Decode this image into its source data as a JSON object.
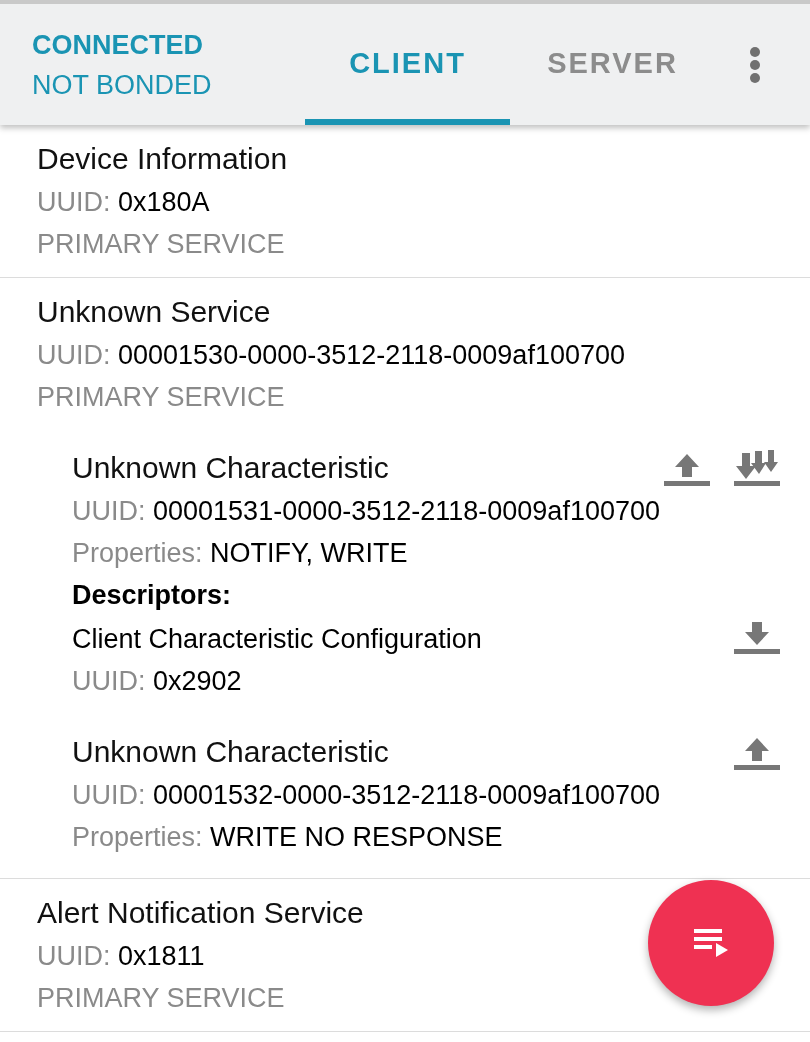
{
  "status": {
    "connection": "CONNECTED",
    "bond": "NOT BONDED"
  },
  "tabs": [
    {
      "label": "CLIENT",
      "selected": true
    },
    {
      "label": "SERVER",
      "selected": false
    }
  ],
  "services": [
    {
      "name": "Device Information",
      "uuid_label": "UUID:",
      "uuid": "0x180A",
      "type": "PRIMARY SERVICE"
    },
    {
      "name": "Unknown Service",
      "uuid_label": "UUID:",
      "uuid": "00001530-0000-3512-2118-0009af100700",
      "type": "PRIMARY SERVICE",
      "characteristics": [
        {
          "name": "Unknown Characteristic",
          "uuid_label": "UUID:",
          "uuid": "00001531-0000-3512-2118-0009af100700",
          "properties_label": "Properties:",
          "properties": "NOTIFY, WRITE",
          "actions": [
            {
              "kind": "write"
            },
            {
              "kind": "notify"
            }
          ],
          "descriptors_label": "Descriptors:",
          "descriptors": [
            {
              "name": "Client Characteristic Configuration",
              "uuid_label": "UUID:",
              "uuid": "0x2902",
              "actions": [
                {
                  "kind": "read"
                }
              ]
            }
          ]
        },
        {
          "name": "Unknown Characteristic",
          "uuid_label": "UUID:",
          "uuid": "00001532-0000-3512-2118-0009af100700",
          "properties_label": "Properties:",
          "properties": "WRITE NO RESPONSE",
          "actions": [
            {
              "kind": "write"
            }
          ]
        }
      ]
    },
    {
      "name": "Alert Notification Service",
      "uuid_label": "UUID:",
      "uuid": "0x1811",
      "type": "PRIMARY SERVICE"
    }
  ]
}
